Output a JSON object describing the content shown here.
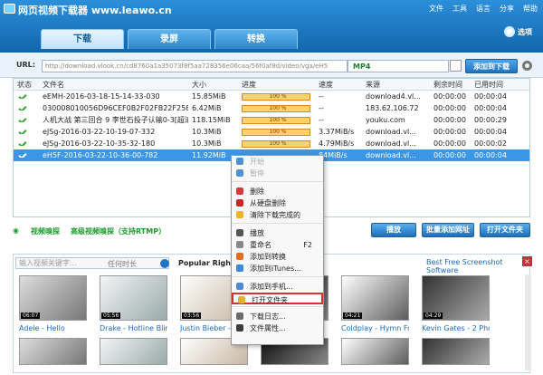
{
  "app": {
    "title": "网页视频下载器 www.leawo.cn",
    "menu": [
      "文件",
      "工具",
      "语言",
      "分享",
      "帮助"
    ]
  },
  "tabs": [
    "下载",
    "录屏",
    "转换"
  ],
  "options": "选项",
  "url": {
    "label": "URL:",
    "value": "http://download.vlook.cn/cd8760a1a35073f8f5aa728356e06caa/56f0af8d/video/vga/eH5",
    "format": "MP4",
    "add": "添加到下载"
  },
  "table": {
    "headers": [
      "状态",
      "文件名",
      "大小",
      "进度",
      "速度",
      "来源",
      "剩余时间",
      "已用时间"
    ],
    "rows": [
      [
        "eEMH-2016-03-18-15-14-33-030",
        "15.85MiB",
        "100 %",
        "--",
        "download4.vl...",
        "00:00:00",
        "00:00:04"
      ],
      [
        "030008010056D96CEF0B2F02FB22F2584FD64...",
        "6.42MiB",
        "100 %",
        "--",
        "183.62.106.72",
        "00:00:00",
        "00:00:04"
      ],
      [
        "人机大战 第三回合 9 李世石投子认输0-3[超清版]",
        "118.15MiB",
        "100 %",
        "--",
        "youku.com",
        "00:00:00",
        "00:00:29"
      ],
      [
        "eJSg-2016-03-22-10-19-07-332",
        "10.3MiB",
        "100 %",
        "3.37MiB/s",
        "download.vl...",
        "00:00:00",
        "00:00:04"
      ],
      [
        "eJSg-2016-03-22-10-35-32-180",
        "10.3MiB",
        "100 %",
        "4.79MiB/s",
        "download.vl...",
        "00:00:00",
        "00:00:02"
      ],
      [
        "eH5F-2016-03-22-10-36-00-782",
        "11.92MiB",
        "",
        "84MiB/s",
        "download.vl...",
        "00:00:00",
        "00:00:04"
      ]
    ]
  },
  "bottom": {
    "sniff": "视频嗅探",
    "advanced": "高级视频嗅探（支持RTMP）",
    "play": "播放",
    "batch": "批量添加网址",
    "open": "打开文件夹"
  },
  "video": {
    "search": "输入视频关键字...",
    "time": "任何时长",
    "popular": "Popular Right No",
    "best": "Best Free Screenshot Software",
    "durations": [
      "06:07",
      "05:56",
      "03:56",
      "",
      "04:21",
      "04:29"
    ],
    "titles": [
      "Adele - Hello",
      "Drake - Hotline Bling",
      "Justin Bieber -",
      "",
      "Coldplay - Hymn For",
      "Kevin Gates - 2 Phones"
    ]
  },
  "context": [
    "开始",
    "暂停",
    "删除",
    "从硬盘删除",
    "清除下载完成的",
    "播放",
    "重命名",
    "添加到转换",
    "添加到iTunes...",
    "添加到手机...",
    "打开文件夹",
    "下载日志...",
    "文件属性..."
  ],
  "context_shortcut": "F2"
}
